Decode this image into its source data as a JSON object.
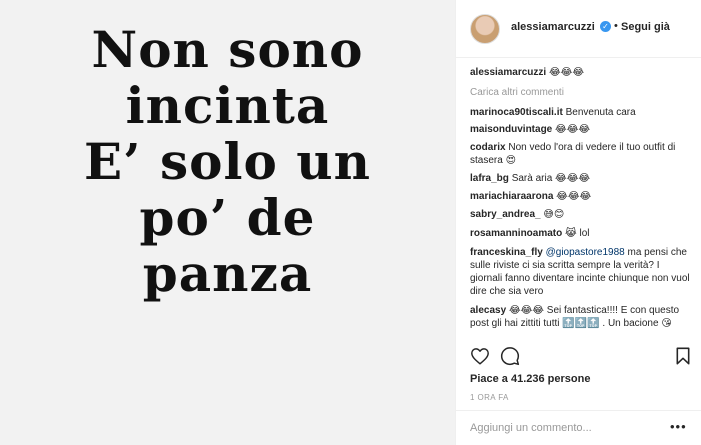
{
  "image": {
    "lines": [
      "Non sono",
      "incinta",
      "E’ solo un",
      "po’ de",
      "panza"
    ]
  },
  "header": {
    "username": "alessiamarcuzzi",
    "verified_icon": "verified-check-icon",
    "separator": "•",
    "follow_label": "Segui già"
  },
  "caption": {
    "user": "alessiamarcuzzi",
    "text": "😂😂😂"
  },
  "load_more_label": "Carica altri commenti",
  "comments": [
    {
      "user": "marinoca90tiscali.it",
      "text": "Benvenuta cara"
    },
    {
      "user": "maisonduvintage",
      "text": "😂😂😂"
    },
    {
      "user": "codarix",
      "text": "Non vedo l'ora di vedere il tuo outfit di stasera 😍"
    },
    {
      "user": "lafra_bg",
      "text": "Sarà aria 😂😂😂"
    },
    {
      "user": "mariachiaraarona",
      "text": "😂😂😂"
    },
    {
      "user": "sabry_andrea_",
      "text": "😅😊"
    },
    {
      "user": "rosamanninoamato",
      "text": "😹 lol"
    },
    {
      "user": "franceskina_fly",
      "mention": "@giopastore1988",
      "text": "ma pensi che sulle riviste ci sia scritta sempre la verità? I giornali fanno diventare incinte chiunque non vuol dire che sia vero"
    },
    {
      "user": "alecasy",
      "text": "😂😂😂 Sei fantastica!!!! E con questo post gli hai zittiti tutti 🔝🔝🔝 . Un bacione 😘"
    }
  ],
  "actions": {
    "like_icon": "heart-icon",
    "comment_icon": "comment-icon",
    "save_icon": "bookmark-icon"
  },
  "likes_text": "Piace a 41.236 persone",
  "timestamp": "1 ORA FA",
  "add_comment": {
    "placeholder": "Aggiungi un commento...",
    "more_label": "•••"
  }
}
